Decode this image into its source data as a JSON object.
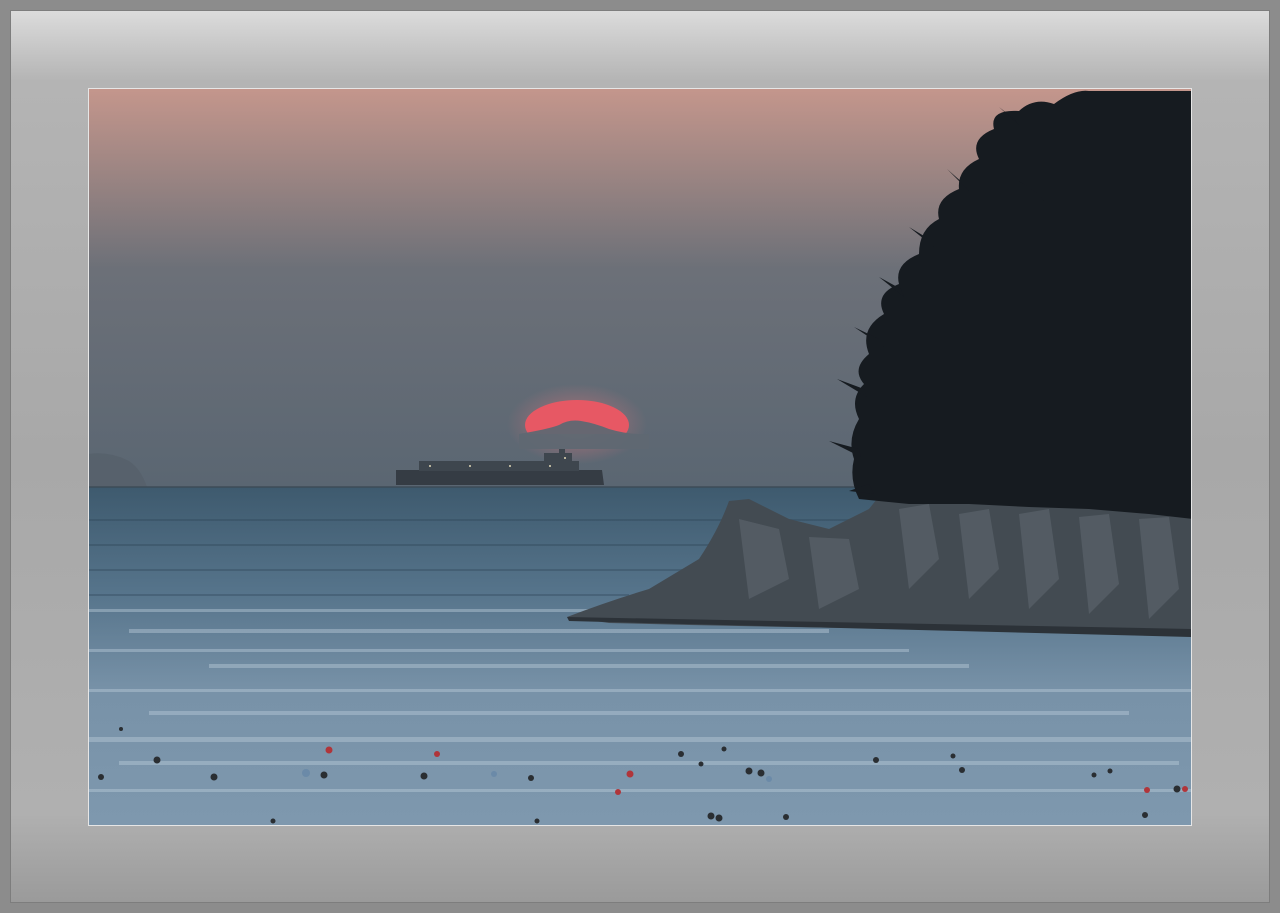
{
  "photo": {
    "subject": "sunset-over-sea",
    "colors": {
      "mat": "#a8a8a8",
      "sky_top": "#c4948a",
      "sky_mid": "#7a7a80",
      "sky_bottom": "#5a6470",
      "sun": "#e85a64",
      "sea": "#4e6a80",
      "sea_highlight": "#9fb6c8",
      "cliff": "#3e464e",
      "trees": "#151a1e",
      "ship": "#3a4148"
    }
  }
}
